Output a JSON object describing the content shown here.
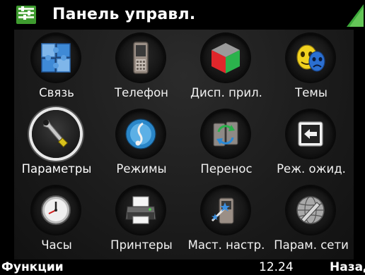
{
  "header": {
    "title": "Панель управл.",
    "app_icon": "control-panel-icon",
    "indicator_icon": "signal-icon"
  },
  "grid": [
    {
      "label": "Связь",
      "icon": "connectivity-icon"
    },
    {
      "label": "Телефон",
      "icon": "phone-icon"
    },
    {
      "label": "Дисп. прил.",
      "icon": "app-manager-icon"
    },
    {
      "label": "Темы",
      "icon": "themes-icon"
    },
    {
      "label": "Параметры",
      "icon": "settings-icon",
      "selected": true
    },
    {
      "label": "Режимы",
      "icon": "profiles-icon"
    },
    {
      "label": "Перенос",
      "icon": "switch-icon"
    },
    {
      "label": "Реж. ожид.",
      "icon": "standby-icon"
    },
    {
      "label": "Часы",
      "icon": "clock-icon"
    },
    {
      "label": "Принтеры",
      "icon": "printer-icon"
    },
    {
      "label": "Маст. настр.",
      "icon": "setup-wizard-icon"
    },
    {
      "label": "Парам. сети",
      "icon": "network-icon"
    }
  ],
  "footer": {
    "left_softkey": "Функции",
    "time": "12.24",
    "right_softkey": "Назад"
  }
}
